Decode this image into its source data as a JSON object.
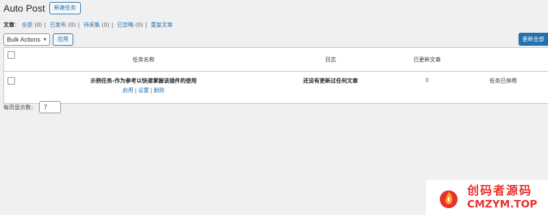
{
  "header": {
    "title": "Auto Post",
    "add_new_label": "新建任务"
  },
  "filters": {
    "label": "文章",
    "colon": "：",
    "items": [
      {
        "label": "全部",
        "count": "(0)"
      },
      {
        "label": "已发布",
        "count": "(0)"
      },
      {
        "label": "待采集",
        "count": "(0)"
      },
      {
        "label": "已忽略",
        "count": "(0)"
      }
    ],
    "extra_link": "重复文章"
  },
  "toolbar": {
    "bulk_select_value": "Bulk Actions",
    "apply_label": "应用",
    "update_all_label": "更新全部"
  },
  "table": {
    "columns": {
      "name": "任务名称",
      "log": "日志",
      "updated": "已更新文章"
    },
    "rows": [
      {
        "name": "示例任务-作为参考以快速掌握该插件的使用",
        "actions": [
          "启用",
          "设置",
          "删除"
        ],
        "log": "还没有更新过任何文章",
        "updated": "0",
        "status": "任务已停用"
      }
    ]
  },
  "pagination": {
    "per_page_label": "每页显示数：",
    "per_page_value": "7"
  },
  "watermark": {
    "line1": "创码者源码",
    "line2": "CMZYM.TOP"
  },
  "colors": {
    "accent": "#2271b1",
    "watermark": "#e8302f"
  }
}
